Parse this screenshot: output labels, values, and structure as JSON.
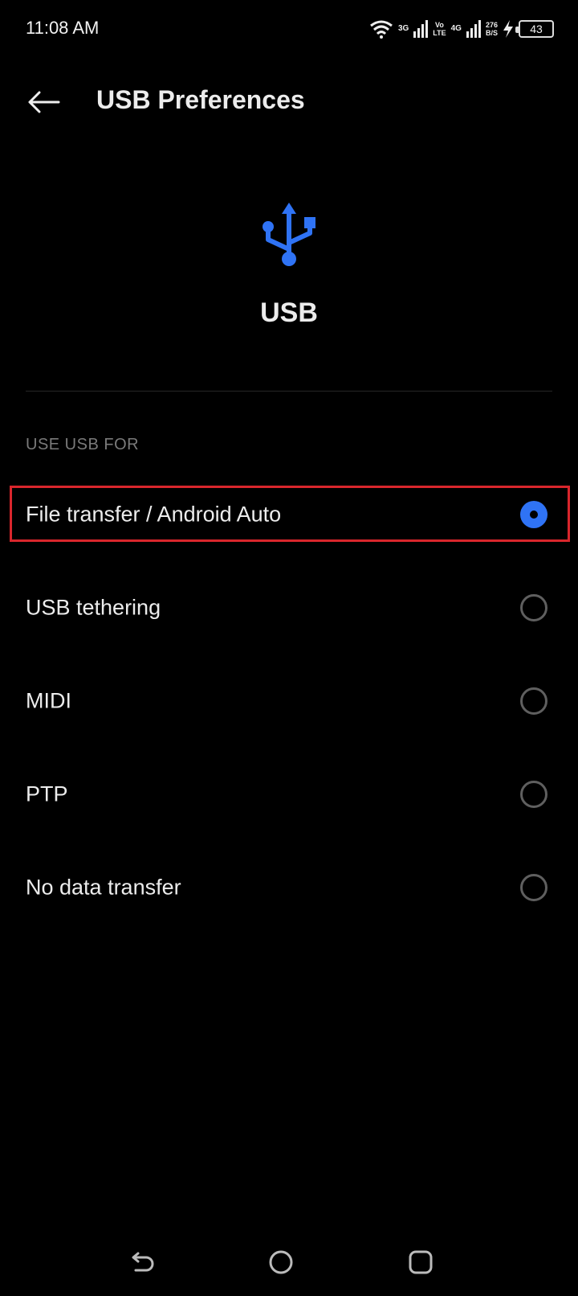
{
  "status_bar": {
    "time": "11:08 AM",
    "net_3g": "3G",
    "volte_top": "Vo",
    "volte_bottom": "LTE",
    "net_4g": "4G",
    "speed_value": "276",
    "speed_unit": "B/S",
    "battery": "43",
    "icons": [
      "wifi-icon",
      "signal-icon",
      "charging-icon",
      "battery-icon"
    ]
  },
  "app_bar": {
    "title": "USB Preferences",
    "back_icon": "arrow-left-icon"
  },
  "header": {
    "icon": "usb-icon",
    "title": "USB"
  },
  "section": {
    "label": "USE USB FOR",
    "options": [
      {
        "label": "File transfer / Android Auto",
        "selected": true
      },
      {
        "label": "USB tethering",
        "selected": false
      },
      {
        "label": "MIDI",
        "selected": false
      },
      {
        "label": "PTP",
        "selected": false
      },
      {
        "label": "No data transfer",
        "selected": false
      }
    ]
  },
  "nav_bar": {
    "icons": [
      "back-nav-icon",
      "home-nav-icon",
      "recents-nav-icon"
    ]
  },
  "colors": {
    "accent": "#2f73f5",
    "highlight": "#d9262c",
    "background": "#000000"
  }
}
